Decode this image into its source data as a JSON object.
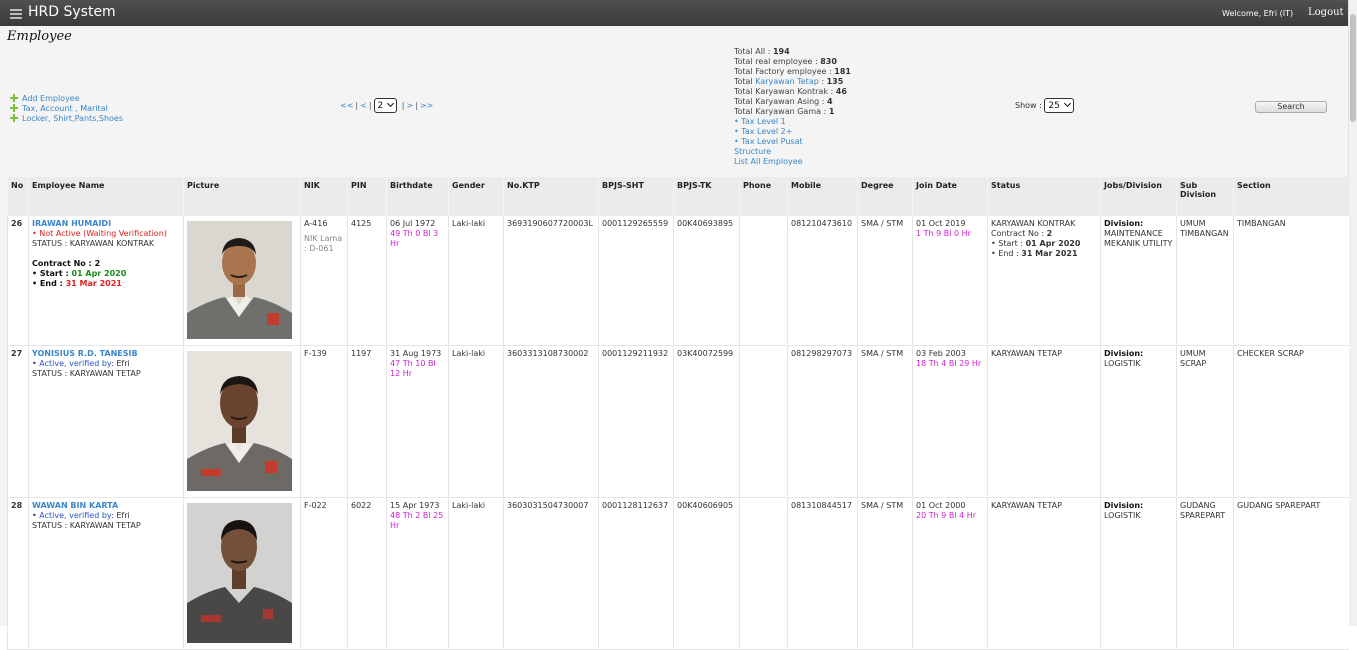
{
  "header": {
    "app_title": "HRD System",
    "welcome": "Welcome, Efri (IT)",
    "logout": "Logout"
  },
  "page": {
    "title": "Employee"
  },
  "actions": [
    "Add Employee",
    "Tax, Account , Marital",
    "Locker, Shirt,Pants,Shoes"
  ],
  "pager": {
    "first": "<<",
    "prev": "<",
    "current": "2",
    "next": ">",
    "last": ">>"
  },
  "stats": {
    "total_all_label": "Total All :",
    "total_all": "194",
    "real_label": "Total real employee :",
    "real": "830",
    "factory_label": "Total Factory employee :",
    "factory": "181",
    "tetap_label_pre": "Total",
    "tetap_label_link": "Karyawan Tetap",
    "tetap_label_post": ":",
    "tetap": "135",
    "kontrak_label": "Total Karyawan Kontrak :",
    "kontrak": "46",
    "asing_label": "Total Karyawan Asing :",
    "asing": "4",
    "gama_label": "Total Karyawan Gama :",
    "gama": "1",
    "links": [
      "• Tax Level 1",
      "• Tax Level 2+",
      "• Tax Level Pusat",
      "Structure",
      "List All Employee"
    ]
  },
  "show": {
    "label": "Show :",
    "value": "25"
  },
  "search_label": "Search",
  "columns": [
    "No",
    "Employee Name",
    "Picture",
    "NIK",
    "PIN",
    "Birthdate",
    "Gender",
    "No.KTP",
    "BPJS-SHT",
    "BPJS-TK",
    "Phone",
    "Mobile",
    "Degree",
    "Join Date",
    "Status",
    "Jobs/Division",
    "Sub Division",
    "Section"
  ],
  "rows": [
    {
      "no": "26",
      "name": "IRAWAN HUMAIDI",
      "active_status": "Not Active (Waiting Verification)",
      "status_line": "STATUS : KARYAWAN KONTRAK",
      "contract_label": "Contract No :",
      "contract_no": "2",
      "start_label": "Start :",
      "start": "01 Apr 2020",
      "end_label": "End :",
      "end": "31 Mar 2021",
      "nik": "A-416",
      "nik_old": "NIK Lama : D-061",
      "pin": "4125",
      "birthdate": "06 Jul 1972",
      "age": "49 Th 0 Bl 3 Hr",
      "gender": "Laki-laki",
      "ktp": "3693190607720003L",
      "bpjs_sht": "0001129265559",
      "bpjs_tk": "00K40693895",
      "phone": "",
      "mobile": "081210473610",
      "degree": "SMA / STM",
      "join_date": "01 Oct 2019",
      "tenure": "1 Th 9 Bl 0 Hr",
      "status": "KARYAWAN KONTRAK",
      "status_contract_label": "Contract No :",
      "status_contract_no": "2",
      "status_start_label": "Start :",
      "status_start": "01 Apr 2020",
      "status_end_label": "End :",
      "status_end": "31 Mar 2021",
      "division_label": "Division:",
      "division": "MAINTENANCE MEKANIK UTILITY",
      "sub_division": "UMUM TIMBANGAN",
      "section": "TIMBANGAN"
    },
    {
      "no": "27",
      "name": "YONISIUS R.D. TANESIB",
      "active_status": "Active, verified by:",
      "verified_by": "Efri",
      "status_line": "STATUS : KARYAWAN TETAP",
      "nik": "F-139",
      "pin": "1197",
      "birthdate": "31 Aug 1973",
      "age": "47 Th 10 Bl 12 Hr",
      "gender": "Laki-laki",
      "ktp": "3603313108730002",
      "bpjs_sht": "0001129211932",
      "bpjs_tk": "03K40072599",
      "phone": "",
      "mobile": "081298297073",
      "degree": "SMA / STM",
      "join_date": "03 Feb 2003",
      "tenure": "18 Th 4 Bl 29 Hr",
      "status": "KARYAWAN TETAP",
      "division_label": "Division:",
      "division": "LOGISTIK",
      "sub_division": "UMUM SCRAP",
      "section": "CHECKER SCRAP"
    },
    {
      "no": "28",
      "name": "WAWAN BIN KARTA",
      "active_status": "Active, verified by:",
      "verified_by": "Efri",
      "status_line": "STATUS : KARYAWAN TETAP",
      "nik": "F-022",
      "pin": "6022",
      "birthdate": "15 Apr 1973",
      "age": "48 Th 2 Bl 25 Hr",
      "gender": "Laki-laki",
      "ktp": "3603031504730007",
      "bpjs_sht": "0001128112637",
      "bpjs_tk": "00K40606905",
      "phone": "",
      "mobile": "081310844517",
      "degree": "SMA / STM",
      "join_date": "01 Oct 2000",
      "tenure": "20 Th 9 Bl 4 Hr",
      "status": "KARYAWAN TETAP",
      "division_label": "Division:",
      "division": "LOGISTIK",
      "sub_division": "GUDANG SPAREPART",
      "section": "GUDANG SPAREPART"
    }
  ],
  "colors": {
    "link": "#3a86c8",
    "inactive": "#e02020",
    "start": "#1a8a1a",
    "age": "#d020d0",
    "topbar": "#424242"
  }
}
